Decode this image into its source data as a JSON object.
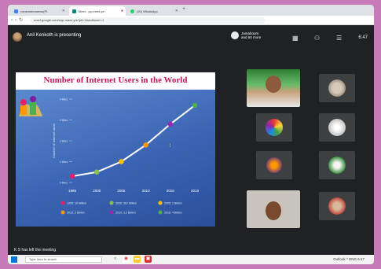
{
  "browser": {
    "tabs": [
      {
        "label": "contendersnews(Pl.",
        "active": false
      },
      {
        "label": "Meet - pp-meet-ye",
        "active": true
      },
      {
        "label": "(20) WhatsApp",
        "active": false
      }
    ],
    "url": "meet.google.com/zap-maxz-yrs?pli=1&authuser=1"
  },
  "meet": {
    "presenter": "Anil Kenkoth is presenting",
    "participants_line1": "Jamaboors",
    "participants_line2": "and 50 more",
    "time": "6:47",
    "notice": "K S has left the meeting"
  },
  "slide": {
    "title": "Number of Internet Users in the World"
  },
  "chart_data": {
    "type": "line",
    "title": "Number of Internet Users in the World",
    "x": [
      "1995",
      "2000",
      "2005",
      "2010",
      "2015",
      "2018"
    ],
    "ylabel": "Number of Internet users",
    "y_ticks": [
      "0 Mios",
      "1 Mios",
      "2 Mios",
      "3 Mios",
      "4 Mios"
    ],
    "values": [
      0.3,
      0.5,
      1.0,
      1.8,
      2.8,
      3.7
    ],
    "point_colors": [
      "#e91e63",
      "#8bc34a",
      "#ffc107",
      "#ff9800",
      "#9c27b0",
      "#4caf50"
    ],
    "legend": [
      "1995: 16 Million",
      "2000: 361 Million",
      "2005: 1 Billion",
      "2010: 2 Billion",
      "2015: 3.2 Billion",
      "2018: 4 Billion"
    ]
  },
  "taskbar": {
    "search_placeholder": "Type here to search",
    "tray": "Outlook   ^  ENG  6:47"
  },
  "colors": {
    "accent": "#c2185b",
    "chart_bg": "#3a64b3",
    "line": "#ffffff"
  }
}
